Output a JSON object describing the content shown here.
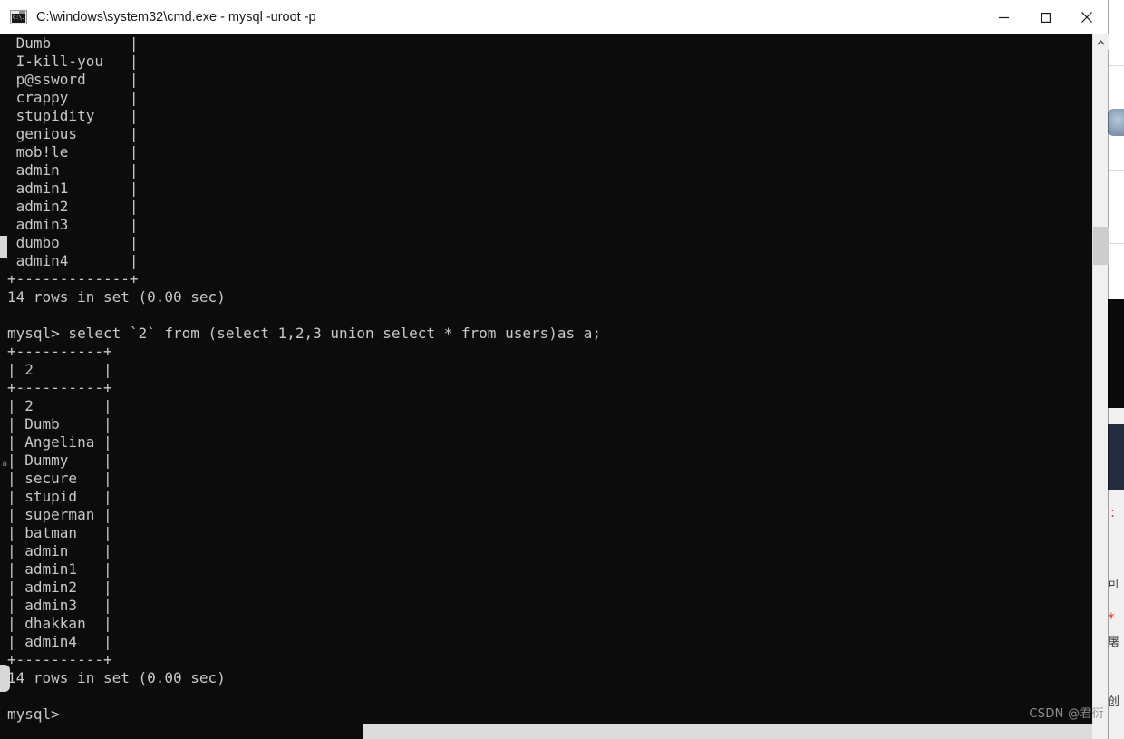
{
  "window": {
    "title": "C:\\windows\\system32\\cmd.exe - mysql  -uroot -p",
    "icon": "cmd-console-icon",
    "controls": {
      "minimize_label": "Minimize",
      "maximize_label": "Maximize",
      "close_label": "Close"
    }
  },
  "console": {
    "background_color": "#0c0c0c",
    "text_color": "#c8c8c8",
    "prompt": "mysql>",
    "query": "mysql> select `2` from (select 1,2,3 union select * from users)as a;",
    "lines": [
      " Dumb         |",
      " I-kill-you   |",
      " p@ssword     |",
      " crappy       |",
      " stupidity    |",
      " genious      |",
      " mob!le       |",
      " admin        |",
      " admin1       |",
      " admin2       |",
      " admin3       |",
      " dumbo        |",
      " admin4       |",
      "+-------------+",
      "14 rows in set (0.00 sec)",
      "",
      "mysql> select `2` from (select 1,2,3 union select * from users)as a;",
      "+----------+",
      "| 2        |",
      "+----------+",
      "| 2        |",
      "| Dumb     |",
      "| Angelina |",
      "| Dummy    |",
      "| secure   |",
      "| stupid   |",
      "| superman |",
      "| batman   |",
      "| admin    |",
      "| admin1   |",
      "| admin2   |",
      "| admin3   |",
      "| dhakkan  |",
      "| admin4   |",
      "+----------+",
      "14 rows in set (0.00 sec)",
      "",
      "mysql>"
    ],
    "first_result_count": "14 rows in set (0.00 sec)",
    "second_result_count": "14 rows in set (0.00 sec)",
    "first_table_values": [
      "Dumb",
      "I-kill-you",
      "p@ssword",
      "crappy",
      "stupidity",
      "genious",
      "mob!le",
      "admin",
      "admin1",
      "admin2",
      "admin3",
      "dumbo",
      "admin4"
    ],
    "second_table_header": "2",
    "second_table_values": [
      "2",
      "Dumb",
      "Angelina",
      "Dummy",
      "secure",
      "stupid",
      "superman",
      "batman",
      "admin",
      "admin1",
      "admin2",
      "admin3",
      "dhakkan",
      "admin4"
    ]
  },
  "scrollbars": {
    "vertical_up_arrow": "chevron-up-icon",
    "vertical_down_arrow": "chevron-down-icon"
  },
  "artifacts": {
    "left_marker": "a"
  },
  "watermark": {
    "text": "CSDN @君衍"
  },
  "background": {
    "red_mark": "*",
    "glyph_1": "可",
    "glyph_2": "屠",
    "glyph_3": "创"
  }
}
